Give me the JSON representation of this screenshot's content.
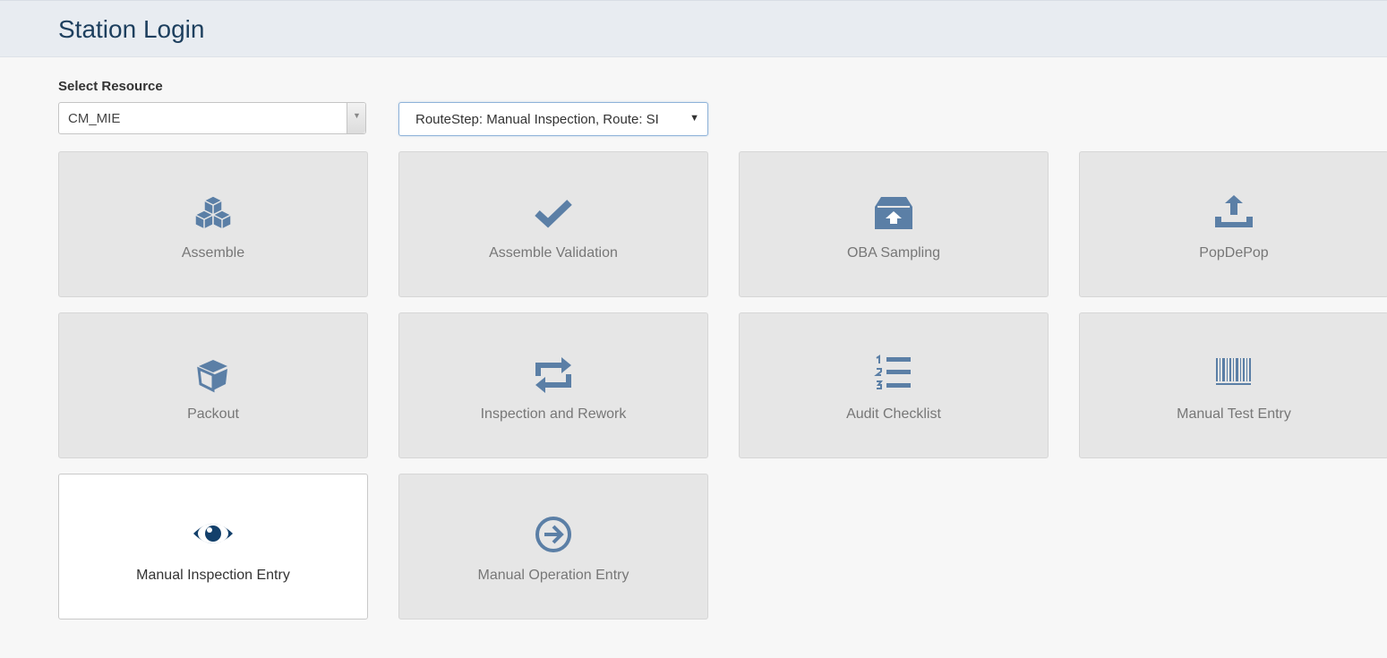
{
  "page_title": "Station Login",
  "resource_label": "Select Resource",
  "resource_select": {
    "value": "CM_MIE"
  },
  "route_select": {
    "value": "RouteStep: Manual Inspection, Route: SI"
  },
  "colors": {
    "icon": "#5b7fa6",
    "icon_active": "#13406b",
    "tile_bg": "#e6e6e6",
    "header_bg": "#e8ecf1"
  },
  "tiles": [
    {
      "label": "Assemble",
      "icon": "cubes-icon"
    },
    {
      "label": "Assemble Validation",
      "icon": "check-icon"
    },
    {
      "label": "OBA Sampling",
      "icon": "archive-upload-icon"
    },
    {
      "label": "PopDePop",
      "icon": "upload-tray-icon"
    },
    {
      "label": "Packout",
      "icon": "open-box-icon"
    },
    {
      "label": "Inspection and Rework",
      "icon": "retweet-icon"
    },
    {
      "label": "Audit Checklist",
      "icon": "ordered-list-icon"
    },
    {
      "label": "Manual Test Entry",
      "icon": "barcode-icon"
    },
    {
      "label": "Manual Inspection Entry",
      "icon": "eye-icon",
      "selected": true
    },
    {
      "label": "Manual Operation Entry",
      "icon": "arrow-circle-right-icon"
    }
  ]
}
